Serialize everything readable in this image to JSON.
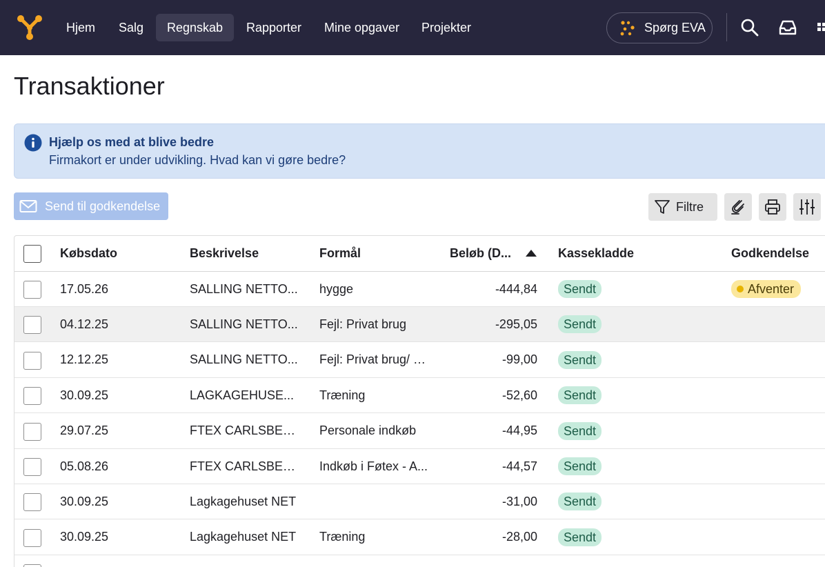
{
  "nav": {
    "items": [
      {
        "label": "Hjem"
      },
      {
        "label": "Salg"
      },
      {
        "label": "Regnskab"
      },
      {
        "label": "Rapporter"
      },
      {
        "label": "Mine opgaver"
      },
      {
        "label": "Projekter"
      }
    ],
    "active_item": "Regnskab",
    "eva_label": "Spørg EVA"
  },
  "page": {
    "title": "Transaktioner"
  },
  "banner": {
    "title": "Hjælp os med at blive bedre",
    "text": "Firmakort er under udvikling. Hvad kan vi gøre bedre?"
  },
  "toolbar": {
    "send_label": "Send til godkendelse",
    "filter_label": "Filtre"
  },
  "table": {
    "columns": {
      "date": "Købsdato",
      "description": "Beskrivelse",
      "purpose": "Formål",
      "amount": "Beløb (D...",
      "kassekladde": "Kassekladde",
      "approval": "Godkendelse"
    },
    "sort": {
      "column": "amount",
      "direction": "ascending"
    },
    "rows": [
      {
        "date": "17.05.26",
        "description": "SALLING NETTO...",
        "purpose": "hygge",
        "amount": "-444,84",
        "kassekladde": "Sendt",
        "approval": "Afventer"
      },
      {
        "date": "04.12.25",
        "description": "SALLING NETTO...",
        "purpose": "Fejl: Privat brug",
        "amount": "-295,05",
        "kassekladde": "Sendt",
        "approval": ""
      },
      {
        "date": "12.12.25",
        "description": "SALLING NETTO...",
        "purpose": "Fejl: Privat brug/ HA",
        "amount": "-99,00",
        "kassekladde": "Sendt",
        "approval": ""
      },
      {
        "date": "30.09.25",
        "description": "LAGKAGEHUSE...",
        "purpose": "Træning",
        "amount": "-52,60",
        "kassekladde": "Sendt",
        "approval": ""
      },
      {
        "date": "29.07.25",
        "description": "FTEX CARLSBERG",
        "purpose": "Personale indkøb",
        "amount": "-44,95",
        "kassekladde": "Sendt",
        "approval": ""
      },
      {
        "date": "05.08.26",
        "description": "FTEX CARLSBERG",
        "purpose": "Indkøb i Føtex - A...",
        "amount": "-44,57",
        "kassekladde": "Sendt",
        "approval": ""
      },
      {
        "date": "30.09.25",
        "description": "Lagkagehuset NET",
        "purpose": "",
        "amount": "-31,00",
        "kassekladde": "Sendt",
        "approval": ""
      },
      {
        "date": "30.09.25",
        "description": "Lagkagehuset NET",
        "purpose": "Træning",
        "amount": "-28,00",
        "kassekladde": "Sendt",
        "approval": ""
      }
    ]
  },
  "colors": {
    "nav_bg": "#27263d",
    "accent_orange": "#f5a623",
    "banner_bg": "#d5e3f6",
    "banner_text": "#1d3e78",
    "send_button_bg": "#a8c1ec",
    "badge_sendt_bg": "#c6ebdc",
    "badge_afventer_bg": "#fbe79c"
  },
  "icons": [
    "logo-icon",
    "eva-icon",
    "search-icon",
    "inbox-icon",
    "apps-grid-icon",
    "info-icon",
    "mail-icon",
    "filter-icon",
    "attach-icon",
    "print-icon",
    "column-settings-icon",
    "sort-ascending-icon"
  ]
}
